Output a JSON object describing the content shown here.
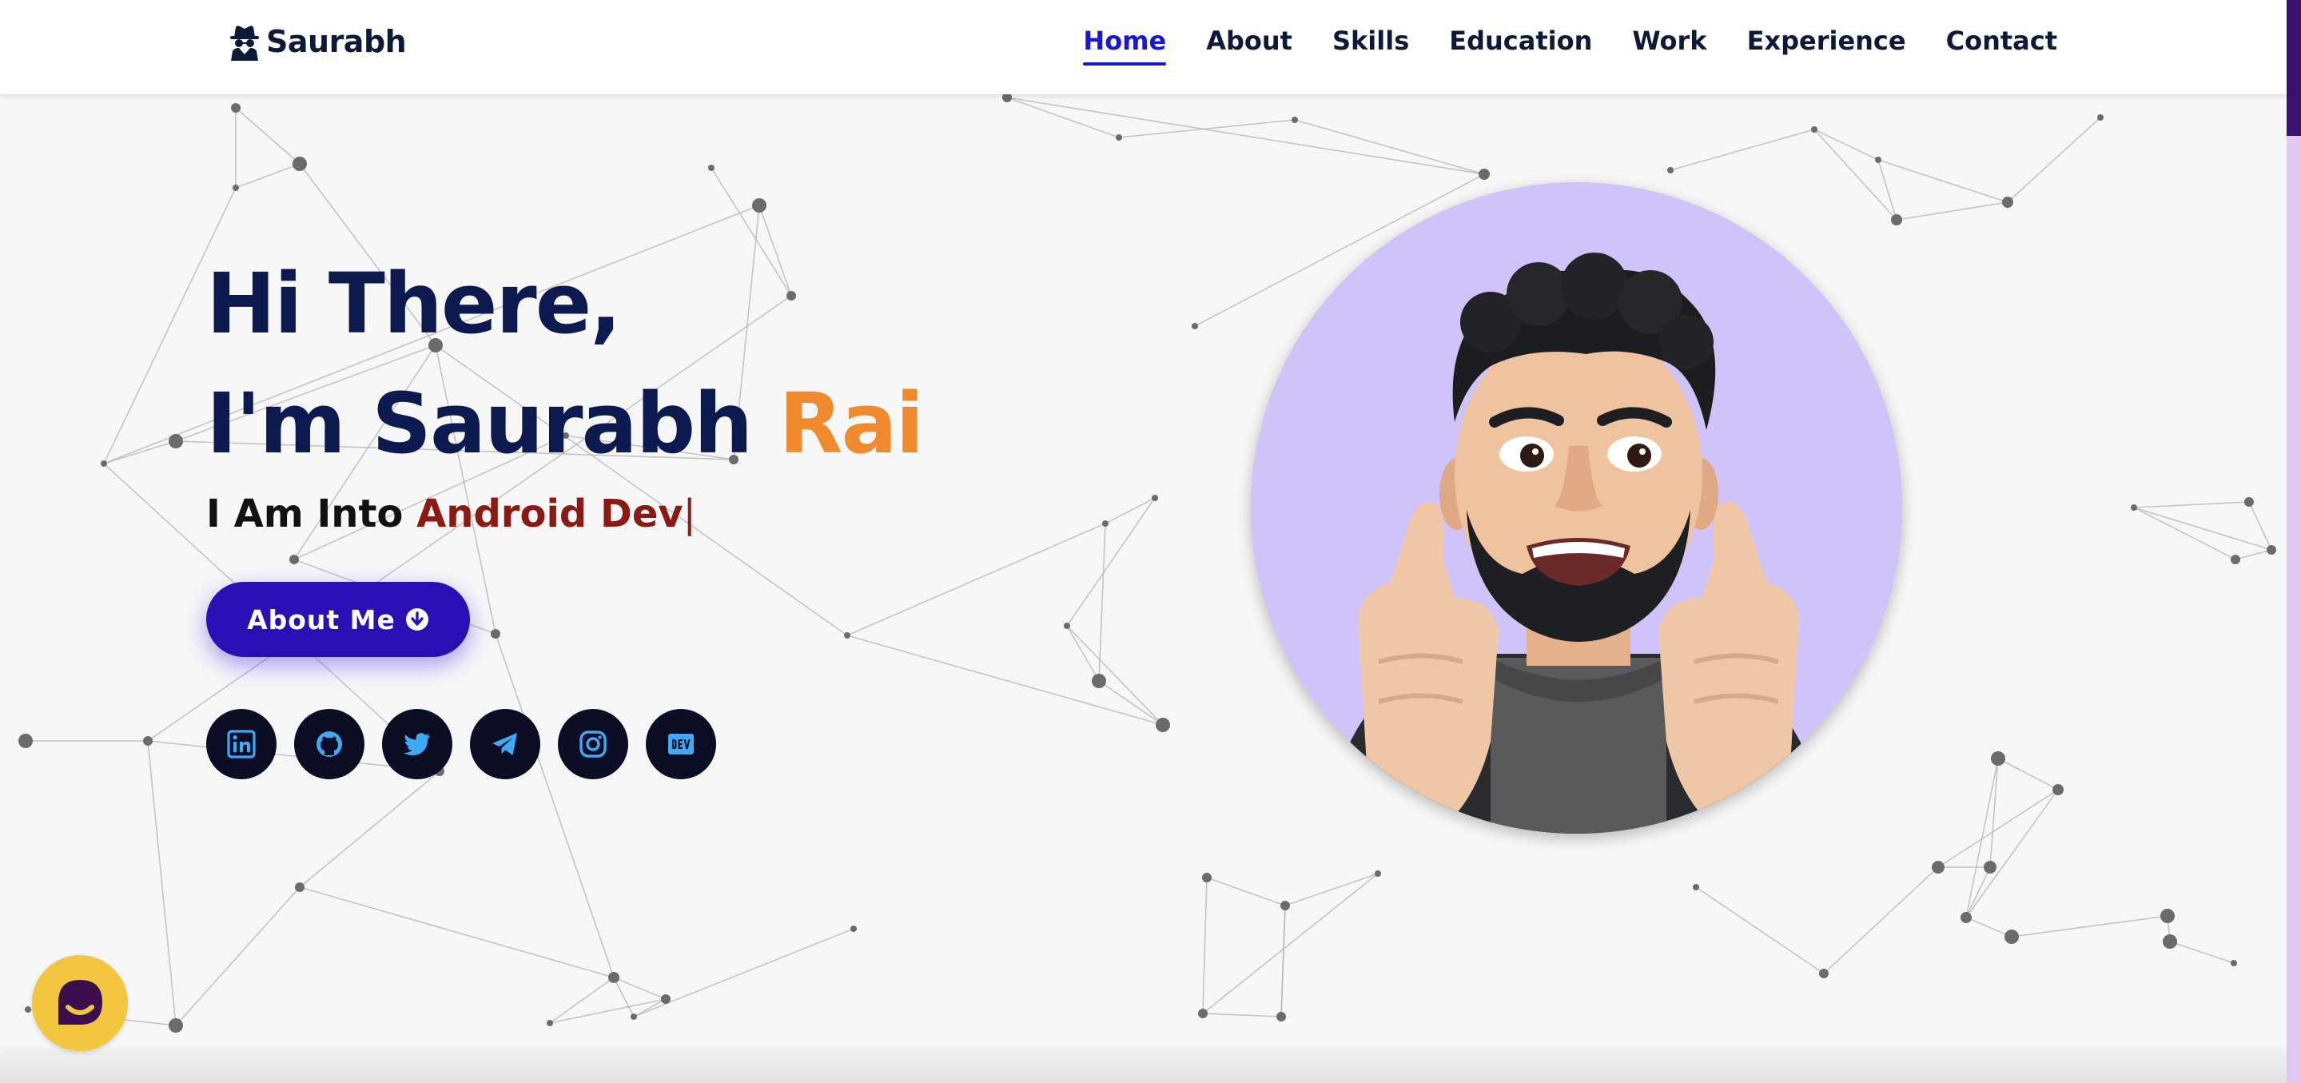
{
  "logo": {
    "text": "Saurabh",
    "icon": "spy-icon"
  },
  "nav": {
    "items": [
      {
        "label": "Home",
        "active": true
      },
      {
        "label": "About",
        "active": false
      },
      {
        "label": "Skills",
        "active": false
      },
      {
        "label": "Education",
        "active": false
      },
      {
        "label": "Work",
        "active": false
      },
      {
        "label": "Experience",
        "active": false
      },
      {
        "label": "Contact",
        "active": false
      }
    ],
    "active_color": "#1a16d6"
  },
  "hero": {
    "greeting": "Hi There,",
    "intro_prefix": "I'm Saurabh",
    "intro_surname": "Rai",
    "subtitle_prefix": "I Am Into",
    "subtitle_role": "Android Dev",
    "typing_cursor": "|",
    "cta_label": "About Me",
    "cta_icon": "arrow-circle-down-icon"
  },
  "socials": [
    {
      "name": "linkedin-icon",
      "label": "LinkedIn"
    },
    {
      "name": "github-icon",
      "label": "GitHub"
    },
    {
      "name": "twitter-icon",
      "label": "Twitter"
    },
    {
      "name": "telegram-icon",
      "label": "Telegram"
    },
    {
      "name": "instagram-icon",
      "label": "Instagram"
    },
    {
      "name": "dev-icon",
      "label": "DEV"
    }
  ],
  "colors": {
    "heading": "#0c1a4f",
    "surname": "#f08a2e",
    "role": "#8b1a14",
    "button": "#2a0fb5",
    "social_bg": "#0a0d24",
    "social_icon": "#3fa9f5",
    "avatar_bg": "#cfc3f9",
    "chat_bubble": "#f3c640"
  },
  "chat_widget": {
    "icon": "chat-bubble-icon"
  }
}
